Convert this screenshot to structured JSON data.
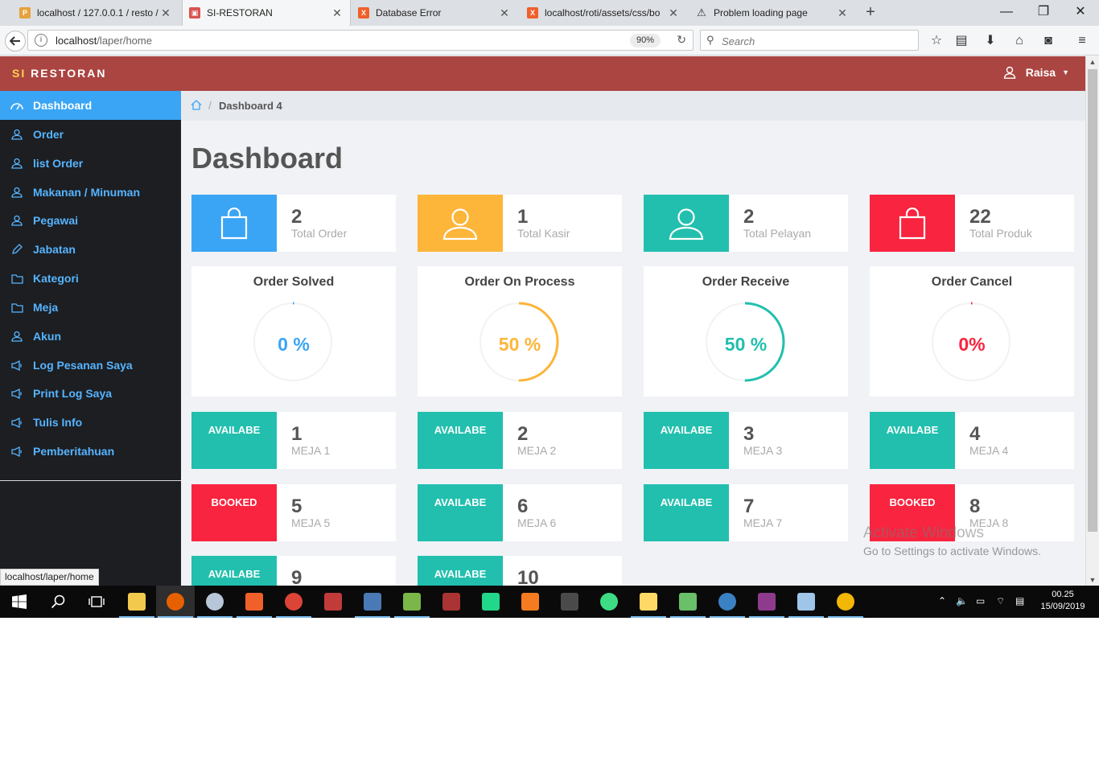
{
  "browser": {
    "tabs": [
      {
        "title": "localhost / 127.0.0.1 / resto /",
        "icon": "phpmyadmin-icon",
        "color": "#e6a23c"
      },
      {
        "title": "SI-RESTORAN",
        "icon": "site-icon",
        "color": "#d9534f"
      },
      {
        "title": "Database Error",
        "icon": "xampp-icon",
        "color": "#f0602a"
      },
      {
        "title": "localhost/roti/assets/css/bo",
        "icon": "xampp-icon",
        "color": "#f0602a"
      },
      {
        "title": "Problem loading page",
        "icon": "warning-icon",
        "color": "#f0c419"
      }
    ],
    "url_host": "localhost",
    "url_path": "/laper/home",
    "zoom": "90%",
    "search_placeholder": "Search",
    "status_url": "localhost/laper/home"
  },
  "app": {
    "brand_si": "SI",
    "brand_rest": "RESTORAN",
    "user": "Raisa",
    "accent": "#ab4542"
  },
  "sidebar": {
    "items": [
      {
        "label": "Dashboard",
        "icon": "dashboard-icon"
      },
      {
        "label": "Order",
        "icon": "user-icon"
      },
      {
        "label": "list Order",
        "icon": "user-icon"
      },
      {
        "label": "Makanan / Minuman",
        "icon": "user-icon"
      },
      {
        "label": "Pegawai",
        "icon": "user-icon"
      },
      {
        "label": "Jabatan",
        "icon": "pencil-icon"
      },
      {
        "label": "Kategori",
        "icon": "folder-icon"
      },
      {
        "label": "Meja",
        "icon": "folder-icon"
      },
      {
        "label": "Akun",
        "icon": "user-icon"
      },
      {
        "label": "Log Pesanan Saya",
        "icon": "megaphone-icon"
      },
      {
        "label": "Print Log Saya",
        "icon": "megaphone-icon"
      },
      {
        "label": "Tulis Info",
        "icon": "megaphone-icon"
      },
      {
        "label": "Pemberitahuan",
        "icon": "megaphone-icon"
      }
    ]
  },
  "breadcrumb": {
    "current": "Dashboard 4"
  },
  "page_title": "Dashboard",
  "stats": [
    {
      "value": "2",
      "label": "Total Order",
      "icon": "shopping-bag-icon",
      "color": "#3aa5f5"
    },
    {
      "value": "1",
      "label": "Total Kasir",
      "icon": "user-icon",
      "color": "#fdb53a"
    },
    {
      "value": "2",
      "label": "Total Pelayan",
      "icon": "user-icon",
      "color": "#22bfae"
    },
    {
      "value": "22",
      "label": "Total Produk",
      "icon": "shopping-bag-icon",
      "color": "#f9243f"
    }
  ],
  "progress": [
    {
      "title": "Order Solved",
      "text": "0 %",
      "value": 0,
      "color": "#3aa5f5"
    },
    {
      "title": "Order On Process",
      "text": "50 %",
      "value": 50,
      "color": "#fdb53a"
    },
    {
      "title": "Order Receive",
      "text": "50 %",
      "value": 50,
      "color": "#22bfae"
    },
    {
      "title": "Order Cancel",
      "text": "0%",
      "value": 0,
      "color": "#f9243f"
    }
  ],
  "tables": [
    {
      "status": "AVAILABE",
      "number": "1",
      "name": "MEJA 1",
      "color": "#22bfae"
    },
    {
      "status": "AVAILABE",
      "number": "2",
      "name": "MEJA 2",
      "color": "#22bfae"
    },
    {
      "status": "AVAILABE",
      "number": "3",
      "name": "MEJA 3",
      "color": "#22bfae"
    },
    {
      "status": "AVAILABE",
      "number": "4",
      "name": "MEJA 4",
      "color": "#22bfae"
    },
    {
      "status": "BOOKED",
      "number": "5",
      "name": "MEJA 5",
      "color": "#f9243f"
    },
    {
      "status": "AVAILABE",
      "number": "6",
      "name": "MEJA 6",
      "color": "#22bfae"
    },
    {
      "status": "AVAILABE",
      "number": "7",
      "name": "MEJA 7",
      "color": "#22bfae"
    },
    {
      "status": "BOOKED",
      "number": "8",
      "name": "MEJA 8",
      "color": "#f9243f"
    },
    {
      "status": "AVAILABE",
      "number": "9",
      "name": "",
      "color": "#22bfae"
    },
    {
      "status": "AVAILABE",
      "number": "10",
      "name": "",
      "color": "#22bfae"
    }
  ],
  "watermark": {
    "line1": "Activate Windows",
    "line2": "Go to Settings to activate Windows."
  },
  "taskbar": {
    "time": "00.25",
    "date": "15/09/2019",
    "apps": [
      "file-explorer-icon",
      "firefox-icon",
      "paint-icon",
      "xampp-icon",
      "chrome-icon",
      "app-icon",
      "app-icon",
      "app-icon",
      "app-icon",
      "pycharm-icon",
      "app-icon",
      "sublime-icon",
      "android-studio-icon",
      "folder-icon",
      "app-icon",
      "app-icon",
      "app-icon",
      "app-icon",
      "app-icon"
    ]
  }
}
